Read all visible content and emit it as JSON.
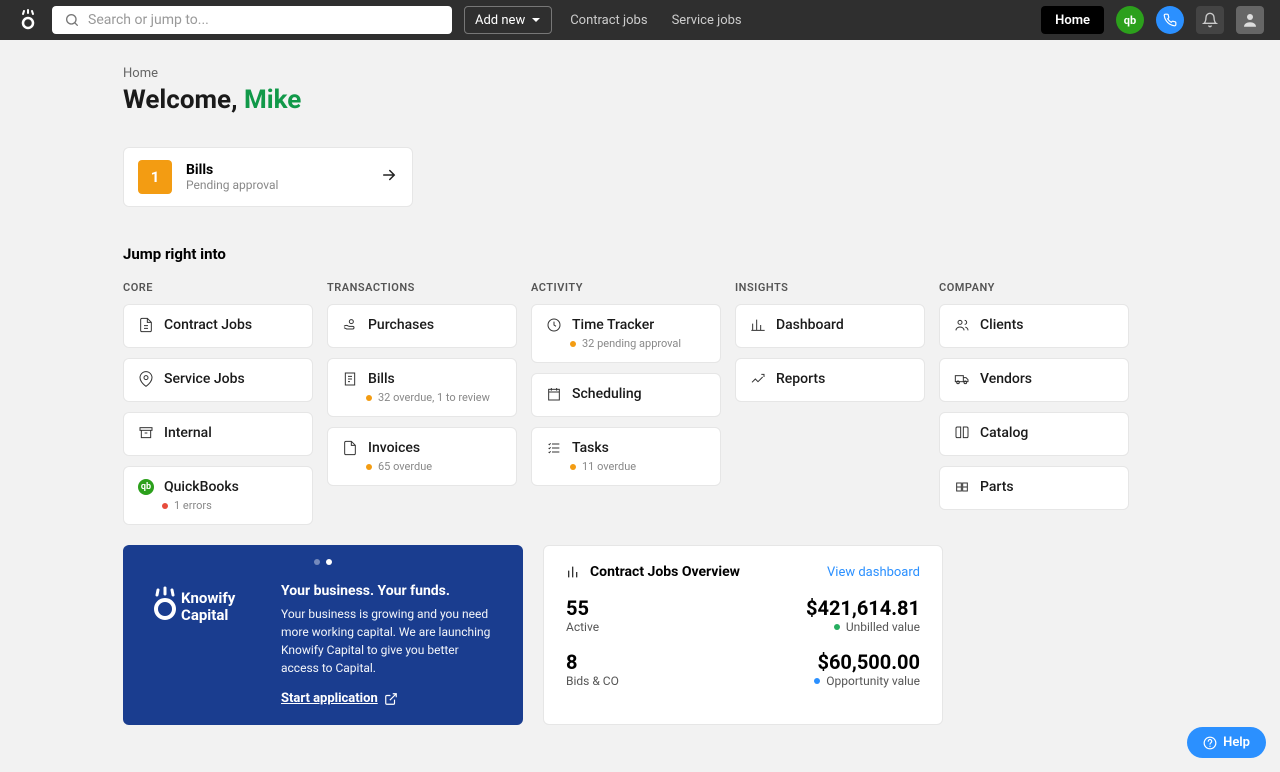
{
  "topbar": {
    "search_placeholder": "Search or jump to...",
    "add_new": "Add new",
    "nav": {
      "contract": "Contract jobs",
      "service": "Service jobs"
    },
    "home": "Home"
  },
  "breadcrumb": "Home",
  "welcome": {
    "prefix": "Welcome, ",
    "name": "Mike"
  },
  "billsCard": {
    "count": "1",
    "title": "Bills",
    "sub": "Pending approval"
  },
  "jump": {
    "heading": "Jump right into"
  },
  "cols": {
    "core": {
      "label": "CORE",
      "items": [
        {
          "title": "Contract Jobs"
        },
        {
          "title": "Service Jobs"
        },
        {
          "title": "Internal"
        },
        {
          "title": "QuickBooks",
          "sub": "1 errors",
          "dot": "red",
          "qb": true
        }
      ]
    },
    "transactions": {
      "label": "TRANSACTIONS",
      "items": [
        {
          "title": "Purchases"
        },
        {
          "title": "Bills",
          "sub": "32 overdue, 1 to review",
          "dot": "or"
        },
        {
          "title": "Invoices",
          "sub": "65 overdue",
          "dot": "or"
        }
      ]
    },
    "activity": {
      "label": "ACTIVITY",
      "items": [
        {
          "title": "Time Tracker",
          "sub": "32 pending approval",
          "dot": "or"
        },
        {
          "title": "Scheduling"
        },
        {
          "title": "Tasks",
          "sub": "11 overdue",
          "dot": "or"
        }
      ]
    },
    "insights": {
      "label": "INSIGHTS",
      "items": [
        {
          "title": "Dashboard"
        },
        {
          "title": "Reports"
        }
      ]
    },
    "company": {
      "label": "COMPANY",
      "items": [
        {
          "title": "Clients"
        },
        {
          "title": "Vendors"
        },
        {
          "title": "Catalog"
        },
        {
          "title": "Parts"
        }
      ]
    }
  },
  "promo": {
    "brand1": "Knowify",
    "brand2": "Capital",
    "title": "Your business. Your funds.",
    "desc": "Your business is growing and you need more working capital. We are launching Knowify Capital to give you better access to Capital.",
    "cta": "Start application"
  },
  "overview": {
    "title": "Contract Jobs Overview",
    "link": "View dashboard",
    "rows": [
      {
        "left_big": "55",
        "left_lbl": "Active",
        "right_big": "$421,614.81",
        "right_lbl": "Unbilled value",
        "dot": "grn"
      },
      {
        "left_big": "8",
        "left_lbl": "Bids & CO",
        "right_big": "$60,500.00",
        "right_lbl": "Opportunity value",
        "dot": "blu"
      }
    ]
  },
  "help": "Help"
}
